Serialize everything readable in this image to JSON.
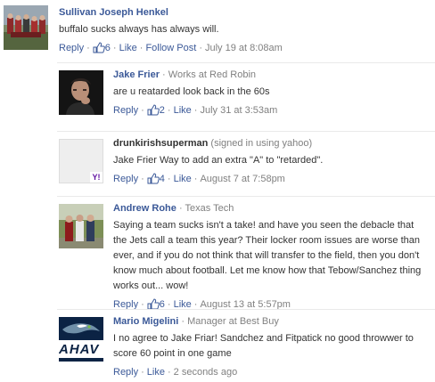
{
  "comments": [
    {
      "author": "Sullivan Joseph Henkel",
      "affiliation": "",
      "text": "buffalo sucks always has always will.",
      "likes": "6",
      "reply_label": "Reply",
      "like_label": "Like",
      "follow_label": "Follow Post",
      "timestamp": "July 19 at 8:08am"
    },
    {
      "author": "Jake Frier",
      "affiliation": "Works at Red Robin",
      "text": "are u reatarded look back in the 60s",
      "likes": "2",
      "reply_label": "Reply",
      "like_label": "Like",
      "timestamp": "July 31 at 3:53am"
    },
    {
      "author": "drunkirishsuperman",
      "affiliation": "(signed in using yahoo)",
      "text": "Jake Frier Way to add an extra \"A\" to \"retarded\".",
      "likes": "4",
      "reply_label": "Reply",
      "like_label": "Like",
      "timestamp": "August 7 at 7:58pm"
    },
    {
      "author": "Andrew Rohe",
      "affiliation": "Texas Tech",
      "text": "Saying a team sucks isn't a take! and have you seen the debacle that the Jets call a team this year? Their locker room issues are worse than ever, and if you do not think that will transfer to the field, then you don't know much about football. Let me know how that Tebow/Sanchez thing works out... wow!",
      "likes": "6",
      "reply_label": "Reply",
      "like_label": "Like",
      "timestamp": "August 13 at 5:57pm"
    },
    {
      "author": "Mario Migelini",
      "affiliation": "Manager at Best Buy",
      "text": "I no agree to Jake Friar! Sandchez and Fitpatick no good throwwer to score 60 point in one game",
      "likes": "",
      "reply_label": "Reply",
      "like_label": "Like",
      "timestamp": "2 seconds ago"
    }
  ],
  "separator": "·",
  "yahoo_badge_letter": "Y!",
  "logo_text": "AHAV",
  "colors": {
    "link": "#3b5998",
    "meta": "#808080",
    "text": "#333333"
  }
}
